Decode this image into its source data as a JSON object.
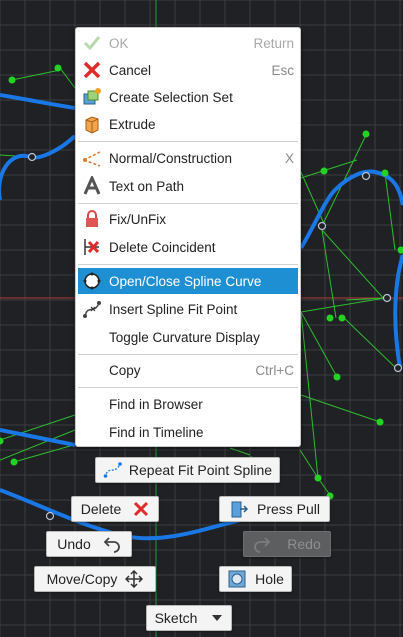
{
  "context_menu": {
    "items": [
      {
        "label": "OK",
        "shortcut": "Return",
        "icon": "checkmark-icon",
        "disabled": true
      },
      {
        "label": "Cancel",
        "shortcut": "Esc",
        "icon": "red-x-icon"
      },
      {
        "label": "Create Selection Set",
        "shortcut": "",
        "icon": "selection-set-icon"
      },
      {
        "label": "Extrude",
        "shortcut": "",
        "icon": "extrude-icon"
      },
      {
        "label": "Normal/Construction",
        "shortcut": "X",
        "icon": "construction-line-icon"
      },
      {
        "label": "Text on Path",
        "shortcut": "",
        "icon": "text-a-icon"
      },
      {
        "label": "Fix/UnFix",
        "shortcut": "",
        "icon": "lock-icon"
      },
      {
        "label": "Delete Coincident",
        "shortcut": "",
        "icon": "delete-coincident-icon"
      },
      {
        "label": "Open/Close Spline Curve",
        "shortcut": "",
        "icon": "open-close-spline-icon",
        "highlighted": true
      },
      {
        "label": "Insert Spline Fit Point",
        "shortcut": "",
        "icon": "insert-fit-point-icon"
      },
      {
        "label": "Toggle Curvature Display",
        "shortcut": "",
        "icon": ""
      },
      {
        "label": "Copy",
        "shortcut": "Ctrl+C",
        "icon": ""
      },
      {
        "label": "Find in Browser",
        "shortcut": "",
        "icon": ""
      },
      {
        "label": "Find in Timeline",
        "shortcut": "",
        "icon": ""
      }
    ]
  },
  "marking_menu": {
    "repeat": "Repeat Fit Point Spline",
    "delete": "Delete",
    "press_pull": "Press Pull",
    "undo": "Undo",
    "redo": "Redo",
    "move_copy": "Move/Copy",
    "hole": "Hole",
    "sketch": "Sketch"
  },
  "colors": {
    "background": "#1f2124",
    "grid": "#3b3d40",
    "spline": "#1a78e6",
    "construction": "#2ebd2e",
    "highlight": "#1e8fd2"
  }
}
